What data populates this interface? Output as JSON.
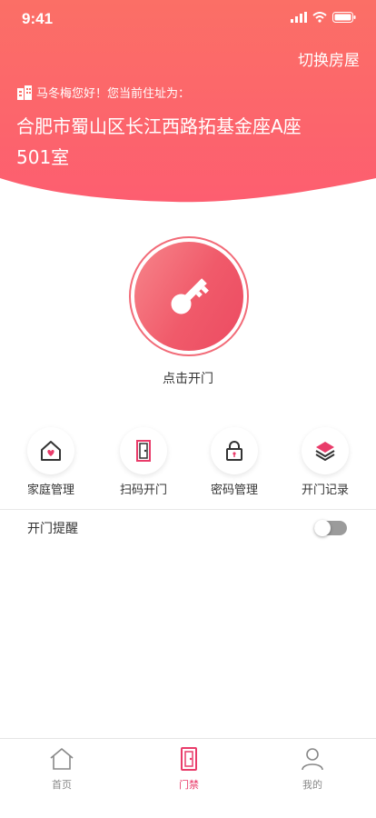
{
  "status_bar": {
    "time": "9:41"
  },
  "header": {
    "switch_label": "切换房屋",
    "greeting": "马冬梅您好！您当前住址为：",
    "address": "合肥市蜀山区长江西路拓基金座A座501室"
  },
  "unlock": {
    "label": "点击开门"
  },
  "menu": [
    {
      "label": "家庭管理",
      "icon": "home-heart-icon"
    },
    {
      "label": "扫码开门",
      "icon": "door-icon"
    },
    {
      "label": "密码管理",
      "icon": "lock-icon"
    },
    {
      "label": "开门记录",
      "icon": "layers-icon"
    }
  ],
  "reminder": {
    "label": "开门提醒",
    "enabled": false
  },
  "tabbar": [
    {
      "label": "首页",
      "icon": "home-icon",
      "active": false
    },
    {
      "label": "门禁",
      "icon": "door-icon",
      "active": true
    },
    {
      "label": "我的",
      "icon": "user-icon",
      "active": false
    }
  ],
  "colors": {
    "accent": "#f05a6a",
    "active_tab": "#e93c6a",
    "header_gradient_top": "#fb6e68",
    "header_gradient_bottom": "#fd5f6e"
  }
}
